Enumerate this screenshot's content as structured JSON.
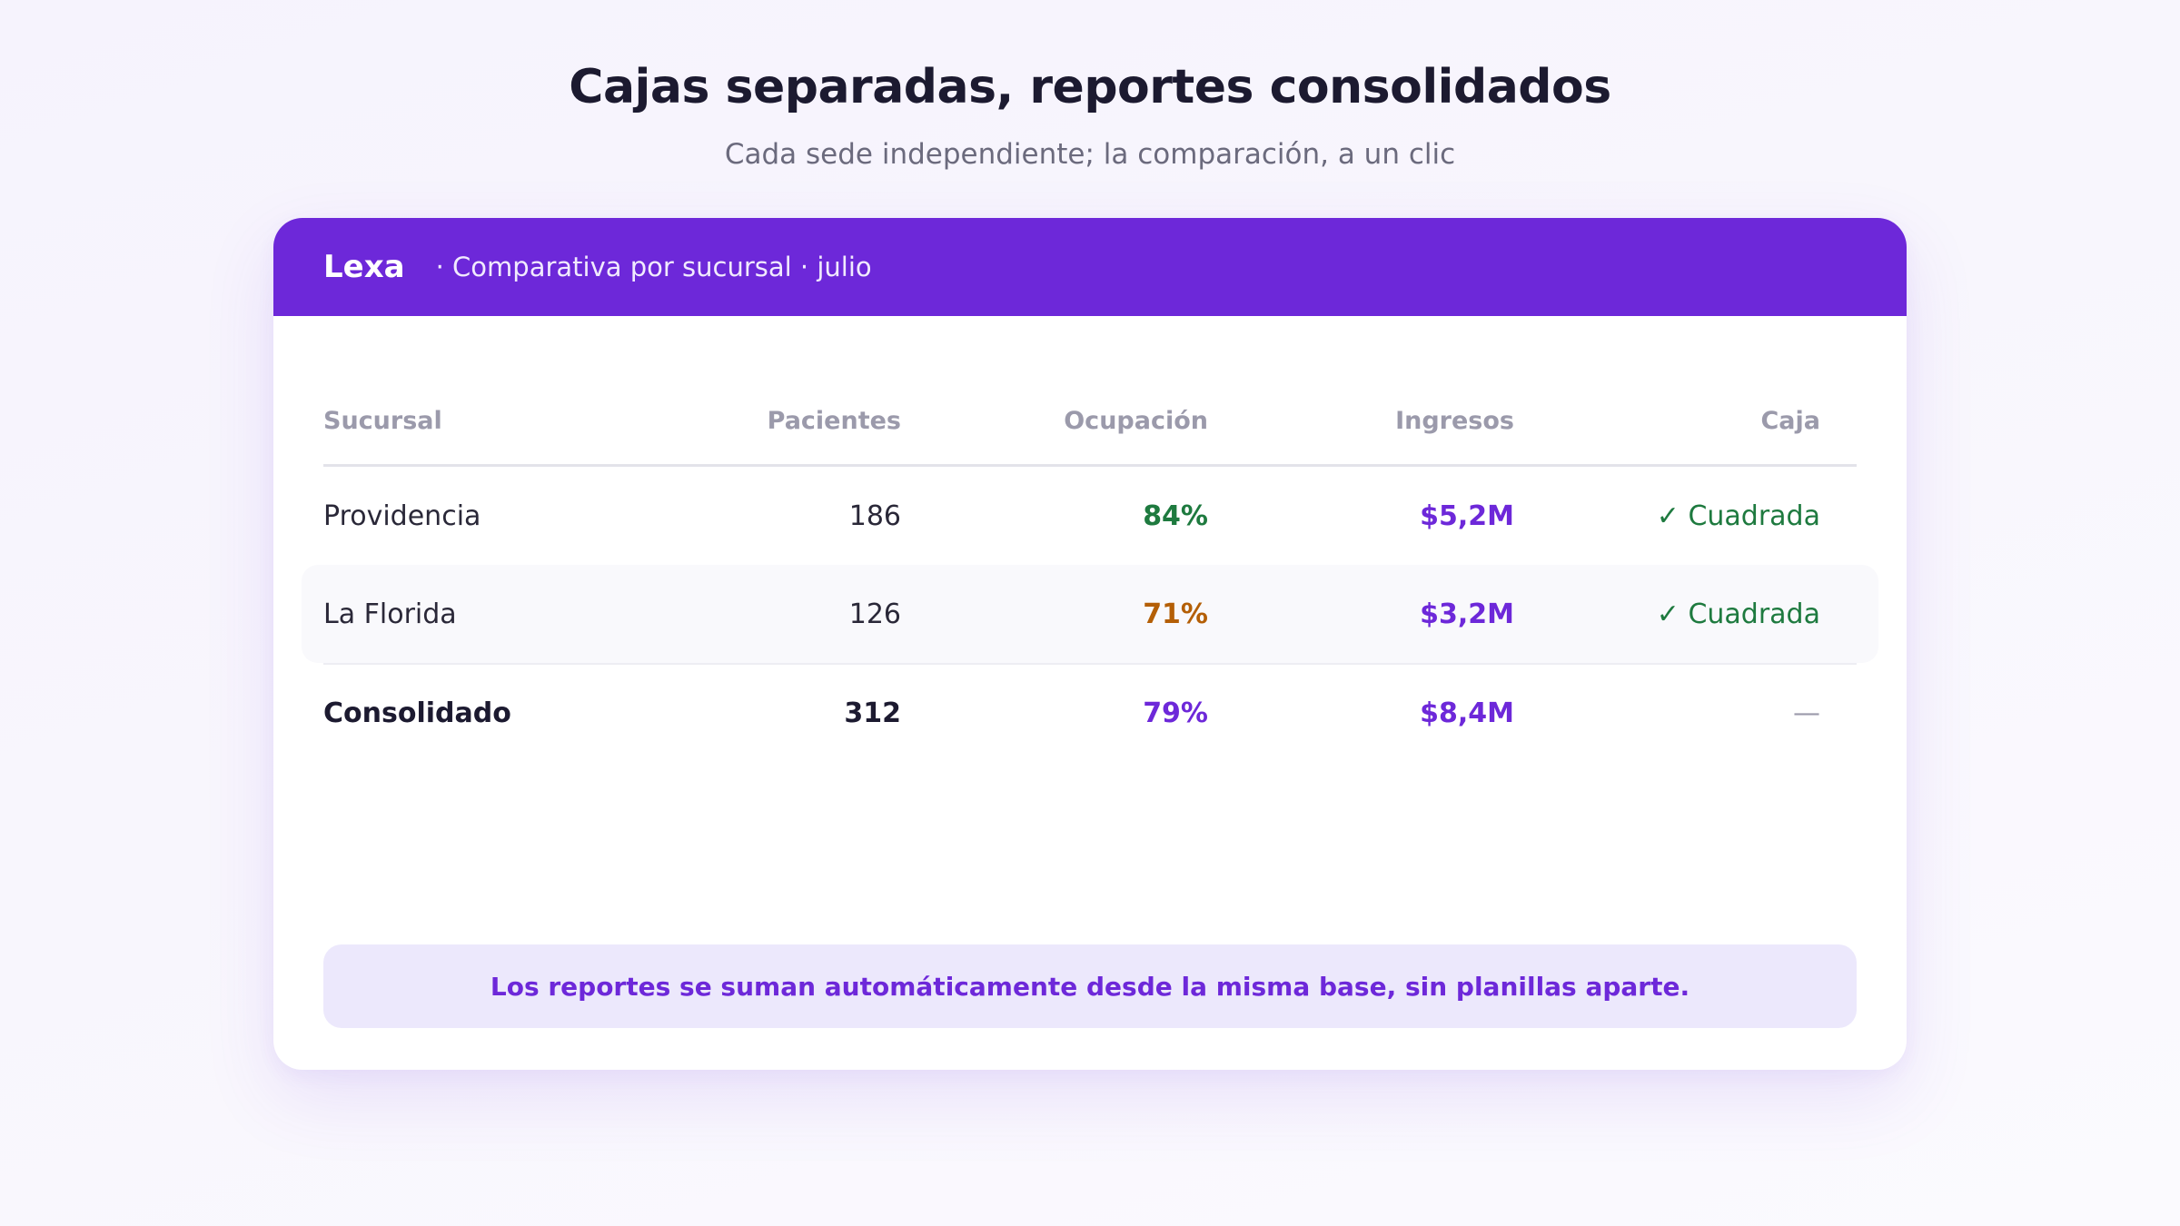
{
  "hero": {
    "title": "Cajas separadas, reportes consolidados",
    "subtitle": "Cada sede independiente; la comparación, a un clic"
  },
  "card": {
    "brand": "Lexa",
    "caption": "· Comparativa por sucursal · julio",
    "columns": [
      "Sucursal",
      "Pacientes",
      "Ocupación",
      "Ingresos",
      "Caja"
    ],
    "rows": [
      {
        "sucursal": "Providencia",
        "pacientes": "186",
        "ocupacion": "84%",
        "ingresos": "$5,2M",
        "caja": "✓ Cuadrada"
      },
      {
        "sucursal": "La Florida",
        "pacientes": "126",
        "ocupacion": "71%",
        "ingresos": "$3,2M",
        "caja": "✓ Cuadrada"
      }
    ],
    "total": {
      "sucursal": "Consolidado",
      "pacientes": "312",
      "ocupacion": "79%",
      "ingresos": "$8,4M",
      "caja": "—"
    },
    "note": "Los reportes se suman automáticamente desde la misma base, sin planillas aparte."
  },
  "colors": {
    "accent": "#6d28d9",
    "good": "#1e7a3f",
    "warning": "#b45f06",
    "note_background": "#ece8fc"
  }
}
